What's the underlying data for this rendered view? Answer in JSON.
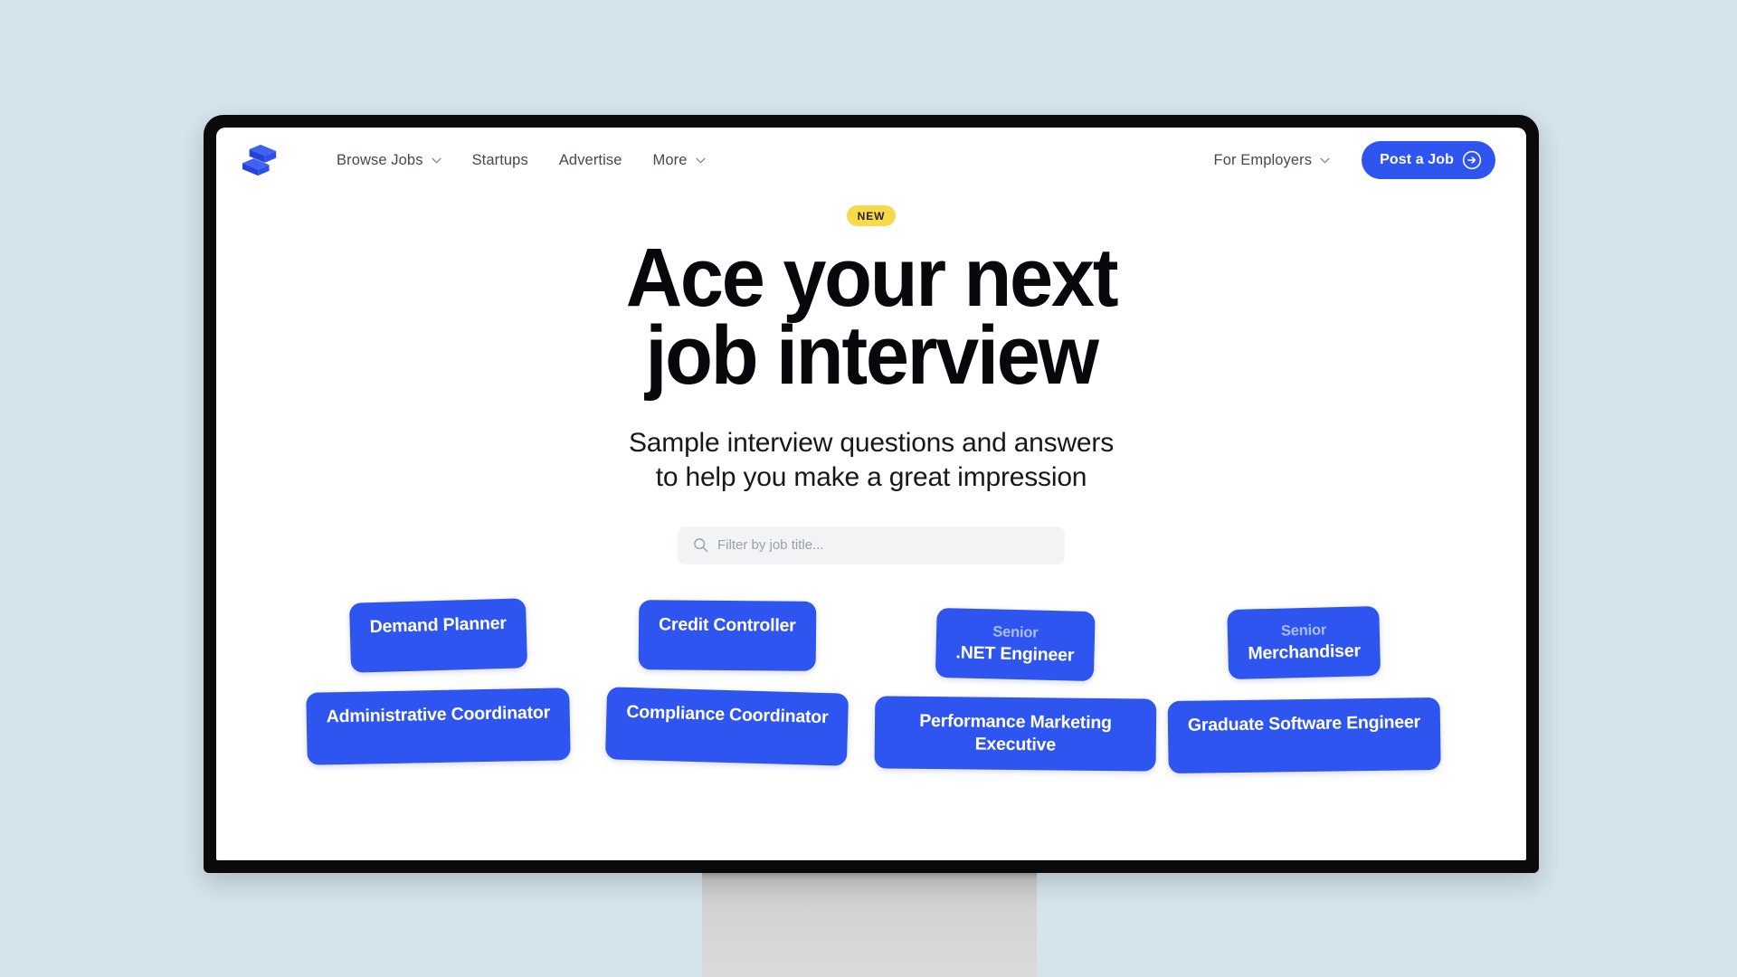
{
  "colors": {
    "page_background": "#d4e3ec",
    "brand_blue": "#2f55f0",
    "badge_yellow": "#f7d94c",
    "senior_prefix": "#a9bef6",
    "bezel": "#0a0a0a"
  },
  "nav": {
    "logo_name": "stacked-blocks-logo",
    "left_items": [
      {
        "label": "Browse Jobs",
        "has_caret": true
      },
      {
        "label": "Startups",
        "has_caret": false
      },
      {
        "label": "Advertise",
        "has_caret": false
      },
      {
        "label": "More",
        "has_caret": true
      }
    ],
    "right_items": [
      {
        "label": "For Employers",
        "has_caret": true
      }
    ],
    "cta": {
      "label": "Post a Job",
      "icon": "arrow-right-circle-icon"
    }
  },
  "hero": {
    "badge": "NEW",
    "headline_line1": "Ace your next",
    "headline_line2": "job interview",
    "subtitle_line1": "Sample interview questions and answers",
    "subtitle_line2": "to help you make a great impression"
  },
  "search": {
    "placeholder": "Filter by job title...",
    "value": "",
    "icon": "search-icon"
  },
  "tags": [
    {
      "prefix": "",
      "title": "Demand Planner"
    },
    {
      "prefix": "",
      "title": "Credit Controller"
    },
    {
      "prefix": "Senior",
      "title": ".NET Engineer"
    },
    {
      "prefix": "Senior",
      "title": "Merchandiser"
    },
    {
      "prefix": "",
      "title": "Administrative Coordinator"
    },
    {
      "prefix": "",
      "title": "Compliance Coordinator"
    },
    {
      "prefix": "",
      "title": "Performance Marketing Executive"
    },
    {
      "prefix": "",
      "title": "Graduate Software Engineer"
    }
  ]
}
